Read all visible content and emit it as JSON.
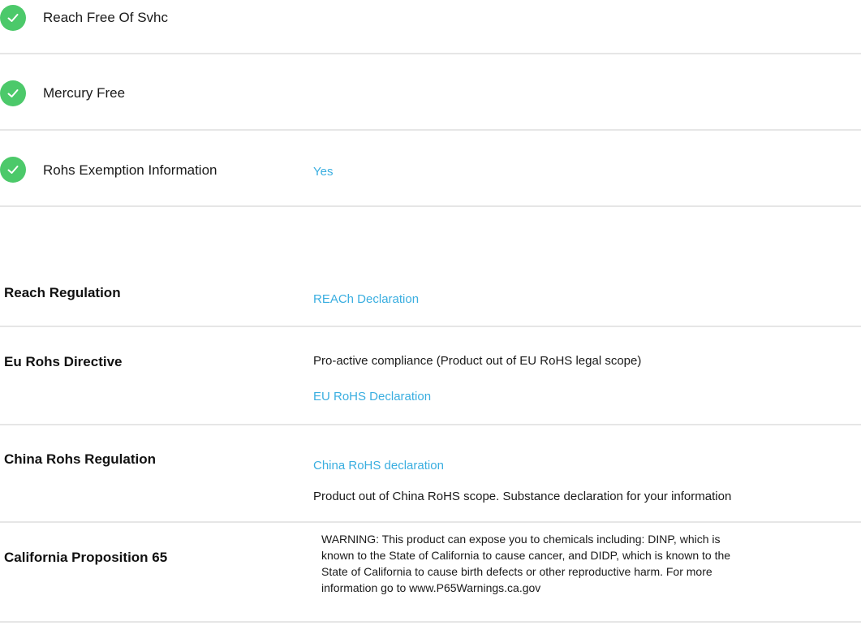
{
  "features": [
    {
      "label": "Reach Free Of Svhc",
      "value": ""
    },
    {
      "label": "Mercury Free",
      "value": ""
    },
    {
      "label": "Rohs Exemption Information",
      "value": "Yes"
    }
  ],
  "regulations": {
    "reach": {
      "label": "Reach Regulation",
      "link": "REACh Declaration"
    },
    "eu_rohs": {
      "label": "Eu Rohs Directive",
      "text": "Pro-active compliance (Product out of EU RoHS legal scope)",
      "link": "EU RoHS Declaration"
    },
    "china_rohs": {
      "label": "China Rohs Regulation",
      "link": "China RoHS declaration",
      "text": "Product out of China RoHS scope. Substance declaration for your information"
    },
    "prop65": {
      "label": "California Proposition 65",
      "lines": [
        "WARNING: This product can expose you to chemicals including: DINP, which is",
        "known to the State of California to cause cancer, and DIDP, which is known to the",
        "State of California to cause birth defects or other reproductive harm. For more",
        "information go to www.P65Warnings.ca.gov"
      ]
    }
  },
  "colors": {
    "check": "#4cc96a",
    "link": "#3aaee0",
    "divider": "#e6e6e6"
  }
}
